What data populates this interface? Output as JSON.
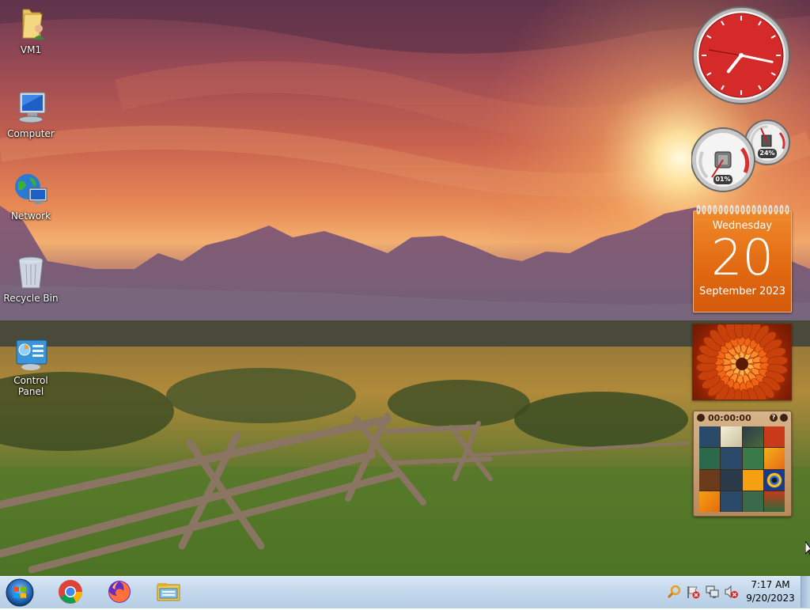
{
  "desktop": {
    "icons": [
      {
        "label": "VM1",
        "icon": "user-folder-icon"
      },
      {
        "label": "Computer",
        "icon": "computer-icon"
      },
      {
        "label": "Network",
        "icon": "network-icon"
      },
      {
        "label": "Recycle Bin",
        "icon": "recycle-bin-icon"
      },
      {
        "label": "Control Panel",
        "icon": "control-panel-icon"
      }
    ]
  },
  "gadgets": {
    "clock": {
      "hour": 7,
      "minute": 17,
      "face_color": "#d42a2a"
    },
    "cpu_meter": {
      "cpu_label": "01%",
      "memory_label": "24%",
      "cpu_value": 1,
      "memory_value": 24
    },
    "calendar": {
      "weekday": "Wednesday",
      "day": "20",
      "month_year": "September 2023",
      "color": "#e26a12"
    },
    "slideshow": {
      "subject": "orange chrysanthemum flower"
    },
    "picture_puzzle": {
      "timer": "00:00:00"
    }
  },
  "taskbar": {
    "start_icon": "windows-start-orb",
    "pinned": [
      {
        "name": "chrome",
        "icon": "chrome-icon"
      },
      {
        "name": "firefox",
        "icon": "firefox-icon"
      },
      {
        "name": "file-explorer",
        "icon": "file-explorer-icon"
      }
    ],
    "tray_icons": [
      "search-magnifier-icon",
      "action-center-flag-icon",
      "network-status-icon",
      "volume-muted-icon"
    ],
    "clock": {
      "time": "7:17 AM",
      "date": "9/20/2023"
    }
  },
  "colors": {
    "taskbar": "#c4d8ec",
    "calendar": "#e26a12",
    "clock_face": "#d42a2a"
  }
}
